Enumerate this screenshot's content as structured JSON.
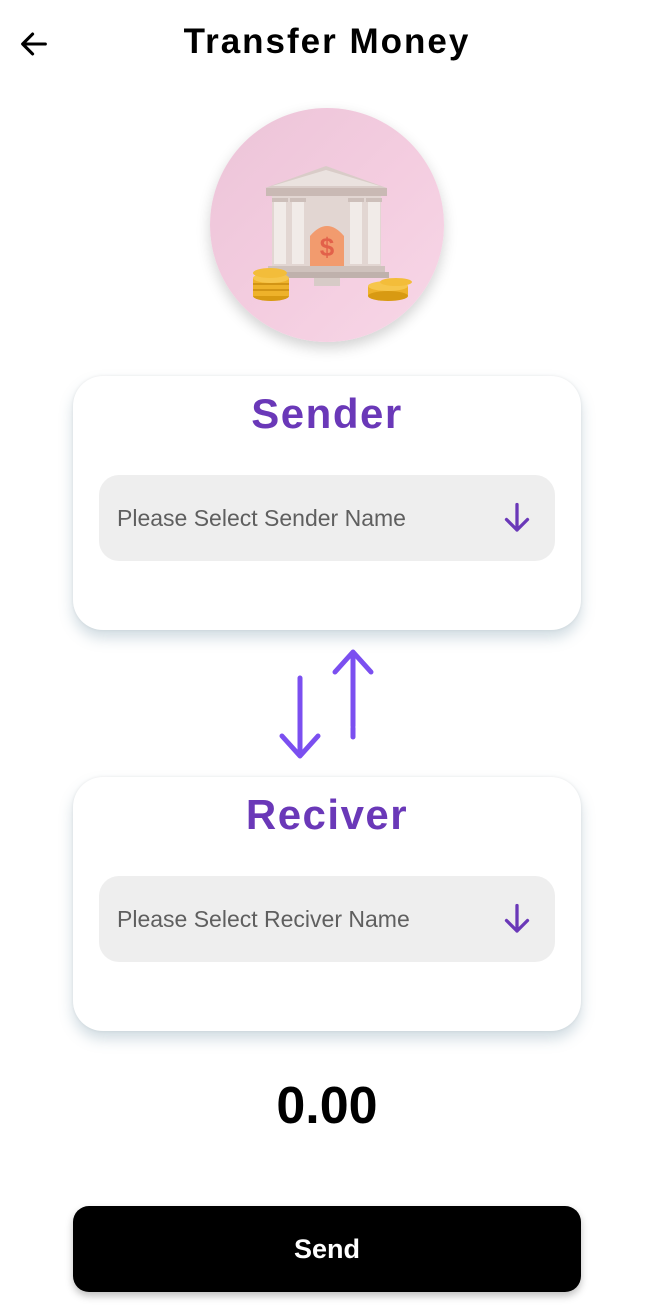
{
  "header": {
    "title": "Transfer Money",
    "back_icon": "arrow-left-icon"
  },
  "avatar": {
    "icon": "bank-building-icon"
  },
  "sender": {
    "title": "Sender",
    "placeholder": "Please Select Sender Name",
    "icon": "arrow-down-icon"
  },
  "swap": {
    "icon": "swap-vertical-icon"
  },
  "receiver": {
    "title": "Reciver",
    "placeholder": "Please Select Reciver Name",
    "icon": "arrow-down-icon"
  },
  "amount": "0.00",
  "actions": {
    "send_label": "Send"
  },
  "colors": {
    "accent": "#6a38b8",
    "swap_accent": "#7b4ff0",
    "field_bg": "#eeeeee",
    "button_bg": "#000000"
  }
}
